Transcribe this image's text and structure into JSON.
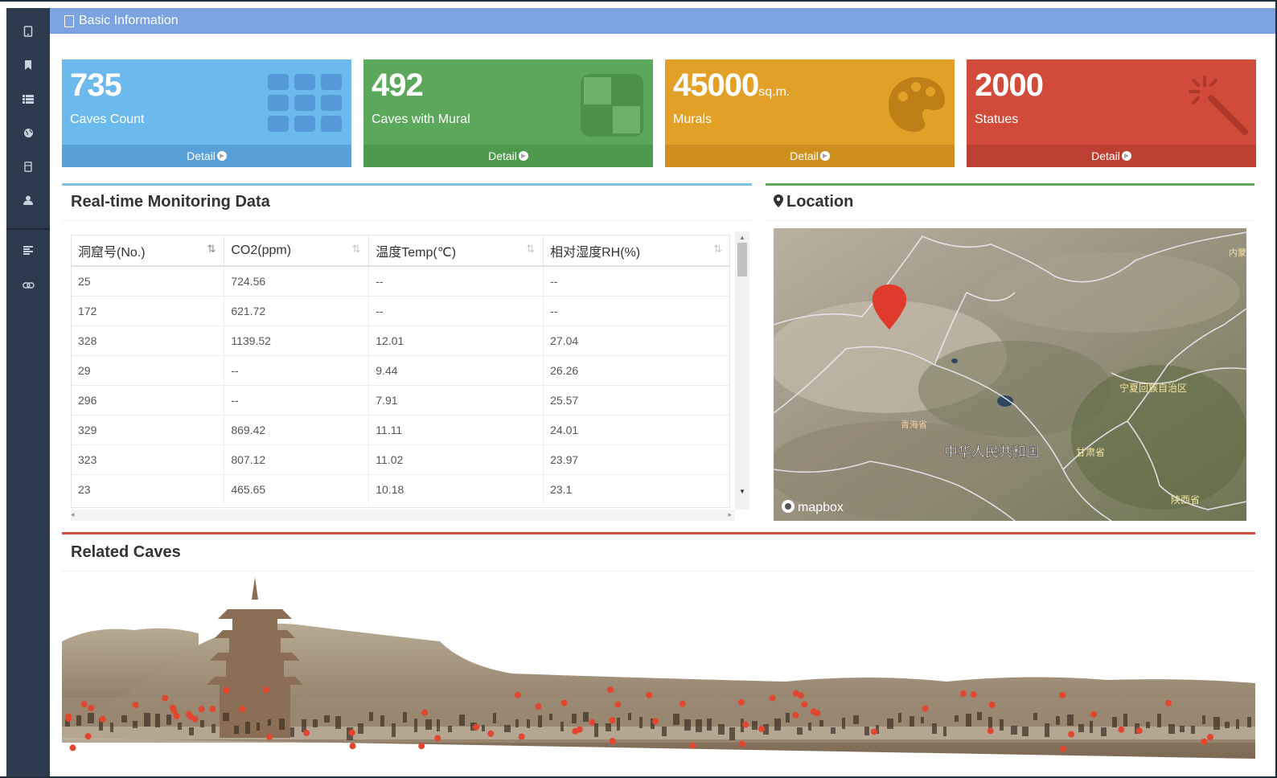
{
  "header": {
    "title": "Basic Information"
  },
  "sidebar": {
    "icons": [
      "tablet-icon",
      "bookmark-icon",
      "list-icon",
      "globe-icon",
      "phone-icon",
      "user-icon",
      "align-left-icon",
      "link-icon"
    ]
  },
  "tiles": [
    {
      "value": "735",
      "unit": "",
      "label": "Caves Count",
      "footer": "Detail",
      "color": "#6cb9ee",
      "icon": "grid-icon"
    },
    {
      "value": "492",
      "unit": "",
      "label": "Caves with Mural",
      "footer": "Detail",
      "color": "#5ba85a",
      "icon": "quadrant-icon"
    },
    {
      "value": "45000",
      "unit": "sq.m.",
      "label": "Murals",
      "footer": "Detail",
      "color": "#e2a027",
      "icon": "palette-icon"
    },
    {
      "value": "2000",
      "unit": "",
      "label": "Statues",
      "footer": "Detail",
      "color": "#d24a3a",
      "icon": "magic-wand-icon"
    }
  ],
  "monitor": {
    "title": "Real-time Monitoring Data",
    "columns": [
      "洞窟号(No.)",
      "CO2(ppm)",
      "温度Temp(℃)",
      "相对湿度RH(%)"
    ],
    "rows": [
      [
        "25",
        "724.56",
        "--",
        "--"
      ],
      [
        "172",
        "621.72",
        "--",
        "--"
      ],
      [
        "328",
        "1139.52",
        "12.01",
        "27.04"
      ],
      [
        "29",
        "--",
        "9.44",
        "26.26"
      ],
      [
        "296",
        "--",
        "7.91",
        "25.57"
      ],
      [
        "329",
        "869.42",
        "11.11",
        "24.01"
      ],
      [
        "323",
        "807.12",
        "11.02",
        "23.97"
      ],
      [
        "23",
        "465.65",
        "10.18",
        "23.1"
      ]
    ]
  },
  "location": {
    "title": "Location",
    "map_labels": {
      "country": "中华人民共和国",
      "gansu": "甘肃省",
      "qinghai": "青海省",
      "shaanxi": "陕西省",
      "ningxia": "宁夏回族自治区",
      "inner_mongolia": "内蒙",
      "attribution": "mapbox"
    }
  },
  "related": {
    "title": "Related Caves"
  }
}
